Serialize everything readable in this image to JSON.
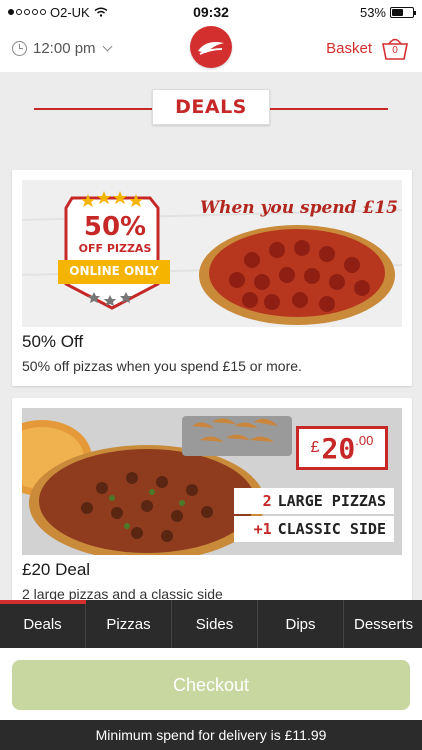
{
  "status_bar": {
    "carrier": "O2-UK",
    "time": "09:32",
    "battery": "53%",
    "battery_level": 0.53
  },
  "header": {
    "time_label": "12:00 pm",
    "basket_label": "Basket",
    "basket_count": "0"
  },
  "section": {
    "title": "DEALS"
  },
  "deals": [
    {
      "title": "50% Off",
      "description": "50% off pizzas when you spend £15 or more."
    },
    {
      "title": "£20 Deal",
      "description": "2 large pizzas and a classic side",
      "price_currency": "£",
      "price_main": "20",
      "price_pence": ".00",
      "line1_accent": "2",
      "line1_text": "LARGE PIZZAS",
      "line2_accent": "+1",
      "line2_text": "CLASSIC SIDE"
    }
  ],
  "promo": {
    "headline": "When you spend £15",
    "badge_main": "50%",
    "badge_sub": "OFF PIZZAS",
    "badge_ribbon": "ONLINE ONLY"
  },
  "tabs": [
    "Deals",
    "Pizzas",
    "Sides",
    "Dips",
    "Desserts"
  ],
  "checkout": {
    "label": "Checkout"
  },
  "footer": {
    "min_spend": "Minimum spend for delivery is £11.99"
  },
  "colors": {
    "brand_red": "#d32f2f",
    "checkout_green": "#c8d6a0",
    "dark_bar": "#2b2b2b"
  }
}
